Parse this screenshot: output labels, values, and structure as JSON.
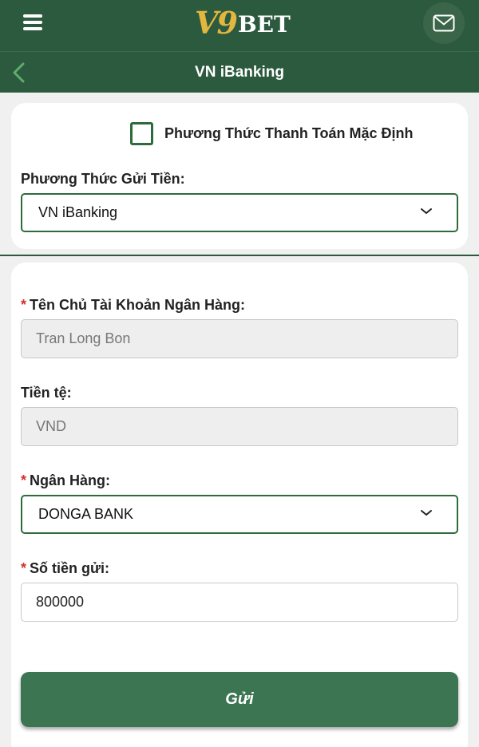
{
  "header": {
    "logo_mark": "V9",
    "logo_text": "BET",
    "icons": {
      "menu": "hamburger-menu-icon",
      "mail": "mail-icon"
    }
  },
  "subheader": {
    "title": "VN iBanking",
    "back_icon": "chevron-left-icon"
  },
  "payment": {
    "default_checkbox_label": "Phương Thức Thanh Toán Mặc Định",
    "default_checked": false,
    "method_label": "Phương Thức Gửi Tiền:",
    "method_value": "VN iBanking"
  },
  "form": {
    "required_mark": "*",
    "account_holder_label": "Tên Chủ Tài Khoản Ngân Hàng:",
    "account_holder_value": "Tran Long Bon",
    "currency_label": "Tiền tệ:",
    "currency_value": "VND",
    "bank_label": "Ngân Hàng:",
    "bank_value": "DONGA BANK",
    "amount_label": "Số tiền gửi:",
    "amount_value": "800000",
    "submit_label": "Gửi"
  },
  "colors": {
    "header_bg": "#2c5a3e",
    "accent_green": "#2e6b3c",
    "button_green": "#3b7552",
    "logo_gold": "#e2b73f",
    "required_red": "#d32f2f"
  }
}
